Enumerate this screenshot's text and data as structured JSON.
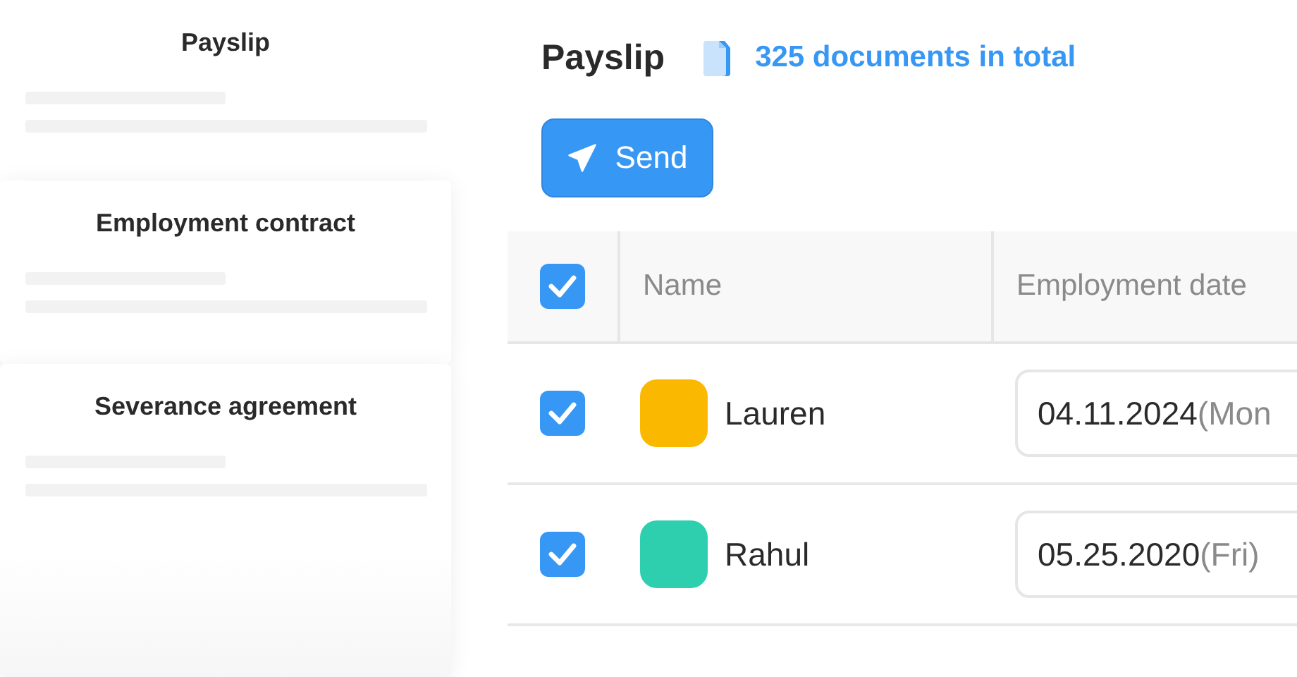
{
  "templates": [
    {
      "title": "Payslip"
    },
    {
      "title": "Employment contract"
    },
    {
      "title": "Severance agreement"
    }
  ],
  "header": {
    "title": "Payslip",
    "count": "325 documents in total"
  },
  "send_button": {
    "label": "Send"
  },
  "table": {
    "all_checked": true,
    "columns": [
      "Name",
      "Employment date"
    ],
    "rows": [
      {
        "checked": true,
        "name": "Lauren",
        "color": "#fbb800",
        "date": "04.11.2024",
        "weekday": "(Mon"
      },
      {
        "checked": true,
        "name": "Rahul",
        "color": "#2dcfae",
        "date": "05.25.2020",
        "weekday": "(Fri)"
      }
    ]
  }
}
